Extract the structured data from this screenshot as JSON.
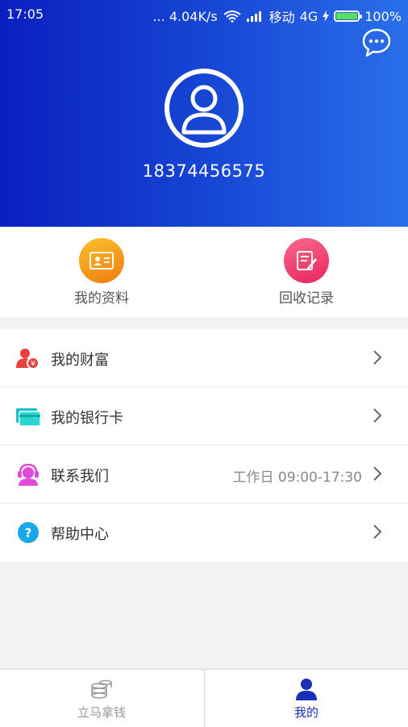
{
  "status_bar": {
    "time": "17:05",
    "network_speed": "... 4.04K/s",
    "carrier": "移动",
    "network_type": "4G",
    "battery": "100%",
    "battery_level": 1.0,
    "icons": [
      "wifi-icon",
      "signal-icon",
      "charging-icon",
      "battery-icon"
    ]
  },
  "profile": {
    "phone": "18374456575",
    "avatar_icon": "user-avatar-icon",
    "chat_icon": "chat-bubble-icon"
  },
  "quick_actions": [
    {
      "label": "我的资料",
      "icon": "id-card-icon",
      "color": "#f6a010"
    },
    {
      "label": "回收记录",
      "icon": "edit-note-icon",
      "color": "#f03a6c"
    }
  ],
  "menu": [
    {
      "label": "我的财富",
      "icon": "wealth-user-icon",
      "extra": ""
    },
    {
      "label": "我的银行卡",
      "icon": "bank-card-icon",
      "extra": ""
    },
    {
      "label": "联系我们",
      "icon": "customer-service-icon",
      "extra": "工作日 09:00-17:30"
    },
    {
      "label": "帮助中心",
      "icon": "help-icon",
      "extra": ""
    }
  ],
  "tabs": [
    {
      "label": "立马拿钱",
      "icon": "coins-icon",
      "active": false
    },
    {
      "label": "我的",
      "icon": "user-icon",
      "active": true
    }
  ],
  "colors": {
    "header_start": "#0a1fbf",
    "header_end": "#2a6fea",
    "active_tab": "#1a2fb8",
    "inactive_tab": "#999999"
  }
}
